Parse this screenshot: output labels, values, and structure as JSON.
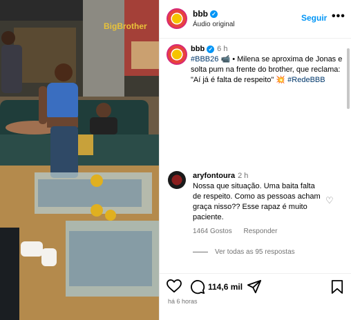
{
  "header": {
    "username": "bbb",
    "verified_mark": "✓",
    "subtitle": "Áudio original",
    "follow_label": "Seguir",
    "more_label": "•••"
  },
  "caption": {
    "username": "bbb",
    "time": "6 h",
    "hashtag_1": "#BBB26",
    "text": "• Milena se aproxima de Jonas e solta pum na frente do brother, que reclama: \"Aí já é falta de respeito\"",
    "hashtag_2": "#RedeBBB"
  },
  "comment": {
    "username": "aryfontoura",
    "time": "2 h",
    "text": "Nossa que situação. Uma baita falta de respeito. Como as pessoas acham graça nisso?? Esse rapaz é muito paciente.",
    "likes": "1464 Gostos",
    "reply_label": "Responder",
    "view_replies": "Ver todas as 95 respostas"
  },
  "actions": {
    "likes_count": "114,6 mil",
    "time_ago": "há 6 horas"
  },
  "icons": {
    "heart": "heart-icon",
    "comment": "comment-icon",
    "share": "share-icon",
    "save": "bookmark-icon"
  },
  "media": {
    "logo_text": "BigBrother"
  },
  "colors": {
    "accent": "#0095f6",
    "tag": "#00376b",
    "muted": "#737373"
  }
}
